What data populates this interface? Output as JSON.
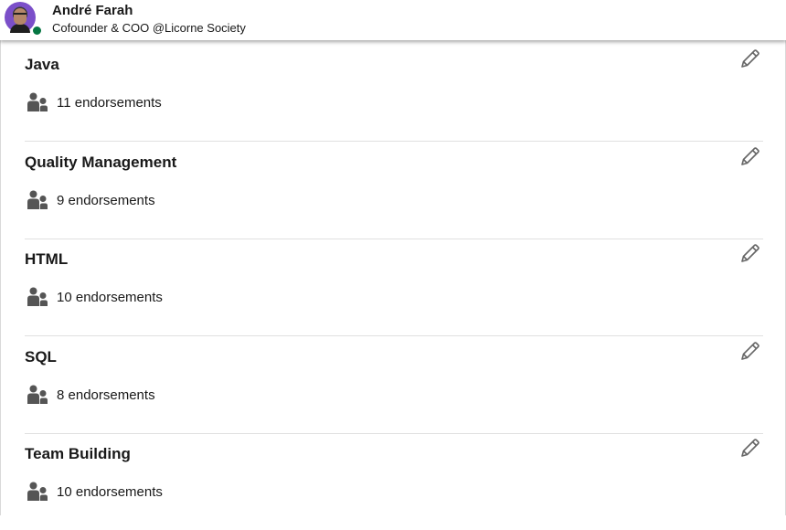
{
  "header": {
    "name": "André Farah",
    "headline": "Cofounder & COO @Licorne Society",
    "presence_color": "#057642"
  },
  "icons": {
    "edit": "pencil-icon",
    "endorsements": "people-icon"
  },
  "skills": [
    {
      "name": "Java",
      "endorsements": "11 endorsements"
    },
    {
      "name": "Quality Management",
      "endorsements": "9 endorsements"
    },
    {
      "name": "HTML",
      "endorsements": "10 endorsements"
    },
    {
      "name": "SQL",
      "endorsements": "8 endorsements"
    },
    {
      "name": "Team Building",
      "endorsements": "10 endorsements"
    }
  ]
}
